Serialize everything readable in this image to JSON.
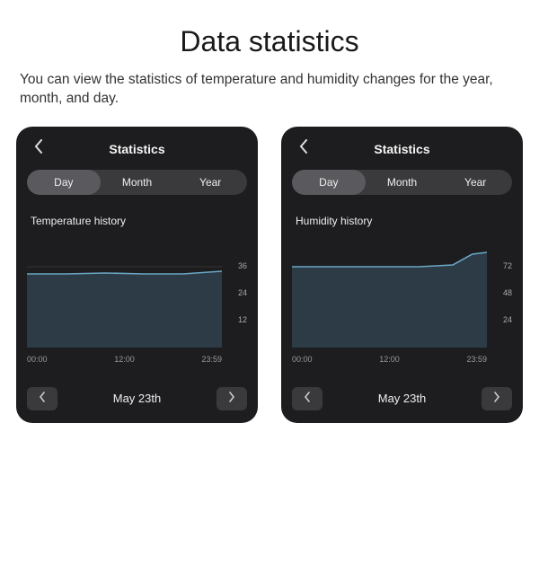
{
  "page": {
    "title": "Data statistics",
    "subtitle": "You can view the statistics of temperature and humidity changes for the year, month, and day."
  },
  "segmented": {
    "day": "Day",
    "month": "Month",
    "year": "Year"
  },
  "screens": [
    {
      "header": "Statistics",
      "chart_title": "Temperature history",
      "y_ticks": [
        "36",
        "24",
        "12"
      ],
      "x_ticks": [
        "00:00",
        "12:00",
        "23:59"
      ],
      "date": "May 23th"
    },
    {
      "header": "Statistics",
      "chart_title": "Humidity history",
      "y_ticks": [
        "72",
        "48",
        "24"
      ],
      "x_ticks": [
        "00:00",
        "12:00",
        "23:59"
      ],
      "date": "May 23th"
    }
  ],
  "chart_data": [
    {
      "type": "area",
      "title": "Temperature history",
      "xlabel": "",
      "ylabel": "",
      "ylim": [
        0,
        36
      ],
      "x": [
        "00:00",
        "12:00",
        "23:59"
      ],
      "series": [
        {
          "name": "temperature",
          "values": [
            28,
            28,
            28.5,
            28,
            28,
            29
          ]
        }
      ]
    },
    {
      "type": "area",
      "title": "Humidity history",
      "xlabel": "",
      "ylabel": "",
      "ylim": [
        0,
        72
      ],
      "x": [
        "00:00",
        "12:00",
        "23:59"
      ],
      "series": [
        {
          "name": "humidity",
          "values": [
            62,
            62,
            62,
            62,
            64,
            70
          ]
        }
      ]
    }
  ]
}
